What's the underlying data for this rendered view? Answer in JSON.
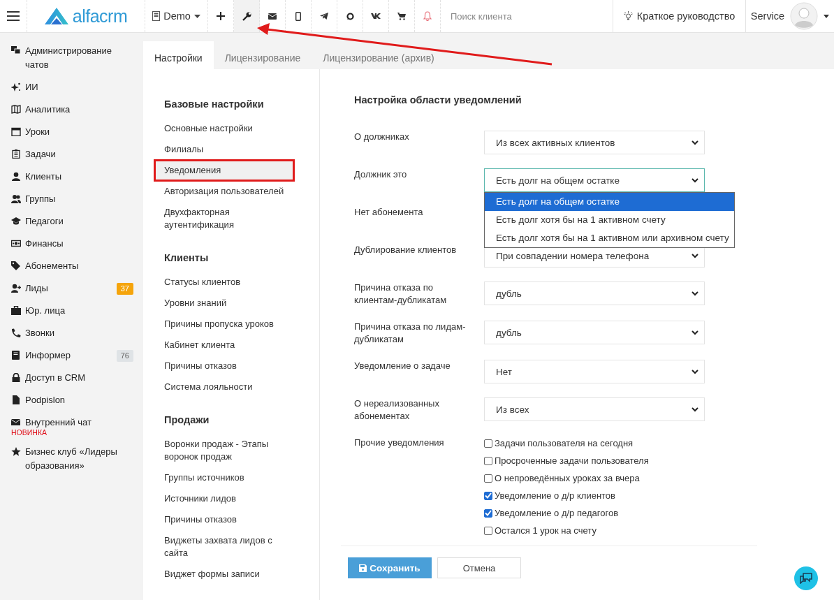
{
  "topbar": {
    "logo": "alfacrm",
    "branch": "Demo",
    "search": {
      "placeholder": "Поиск клиента"
    },
    "guide": "Краткое руководство",
    "user": "Service",
    "toolbar_buttons": [
      {
        "selected": false
      },
      {
        "selected": true
      },
      {
        "selected": false
      },
      {
        "selected": false
      },
      {
        "selected": false
      },
      {
        "selected": false
      },
      {
        "selected": false
      },
      {
        "selected": false
      },
      {
        "selected": false
      }
    ]
  },
  "sidebar": {
    "items": [
      {
        "label": "Администрирование чатов"
      },
      {
        "label": "ИИ"
      },
      {
        "label": "Аналитика"
      },
      {
        "label": "Уроки"
      },
      {
        "label": "Задачи"
      },
      {
        "label": "Клиенты"
      },
      {
        "label": "Группы"
      },
      {
        "label": "Педагоги"
      },
      {
        "label": "Финансы"
      },
      {
        "label": "Абонементы"
      },
      {
        "label": "Лиды",
        "badge": {
          "text": "37",
          "color": "#f5a40b"
        }
      },
      {
        "label": "Юр. лица"
      },
      {
        "label": "Звонки"
      },
      {
        "label": "Информер",
        "badge": {
          "text": "76",
          "color": "#dfe3e6"
        }
      },
      {
        "label": "Доступ в CRM"
      },
      {
        "label": "Podpislon"
      },
      {
        "label": "Внутренний чат",
        "note": "НОВИНКА"
      },
      {
        "label": "Бизнес клуб «Лидеры образования»"
      }
    ]
  },
  "tabs": [
    {
      "label": "Настройки",
      "selected": true
    },
    {
      "label": "Лицензирование",
      "selected": false
    },
    {
      "label": "Лицензирование (архив)",
      "selected": false
    }
  ],
  "settings_nav": [
    {
      "title": "Базовые настройки",
      "items": [
        {
          "label": "Основные настройки",
          "selected": false,
          "outlined": false
        },
        {
          "label": "Филиалы",
          "selected": false,
          "outlined": false
        },
        {
          "label": "Уведомления",
          "selected": true,
          "outlined": true
        },
        {
          "label": "Авторизация пользователей",
          "selected": false,
          "outlined": false
        },
        {
          "label": "Двухфакторная аутентификация",
          "selected": false,
          "outlined": false
        }
      ]
    },
    {
      "title": "Клиенты",
      "items": [
        {
          "label": "Статусы клиентов",
          "selected": false,
          "outlined": false
        },
        {
          "label": "Уровни знаний",
          "selected": false,
          "outlined": false
        },
        {
          "label": "Причины пропуска уроков",
          "selected": false,
          "outlined": false
        },
        {
          "label": "Кабинет клиента",
          "selected": false,
          "outlined": false
        },
        {
          "label": "Причины отказов",
          "selected": false,
          "outlined": false
        },
        {
          "label": "Система лояльности",
          "selected": false,
          "outlined": false
        }
      ]
    },
    {
      "title": "Продажи",
      "items": [
        {
          "label": "Воронки продаж - Этапы воронок продаж",
          "selected": false,
          "outlined": false
        },
        {
          "label": "Группы источников",
          "selected": false,
          "outlined": false
        },
        {
          "label": "Источники лидов",
          "selected": false,
          "outlined": false
        },
        {
          "label": "Причины отказов",
          "selected": false,
          "outlined": false
        },
        {
          "label": "Виджеты захвата лидов с сайта",
          "selected": false,
          "outlined": false
        },
        {
          "label": "Виджет формы записи",
          "selected": false,
          "outlined": false
        }
      ]
    }
  ],
  "form": {
    "title": "Настройка области уведомлений",
    "fields": [
      {
        "kind": "select",
        "label": "О должниках",
        "value": "Из всех активных клиентов",
        "focused": false
      },
      {
        "kind": "select",
        "label": "Должник это",
        "value": "Есть долг на общем остатке",
        "focused": true,
        "options": [
          {
            "label": "Есть долг на общем остатке",
            "selected": true
          },
          {
            "label": "Есть долг хотя бы на 1 активном счету",
            "selected": false
          },
          {
            "label": "Есть долг хотя бы на 1 активном или архивном счету",
            "selected": false
          }
        ]
      },
      {
        "kind": "hidden",
        "label": "Нет абонемента"
      },
      {
        "kind": "select",
        "label": "Дублирование клиентов",
        "value": "При совпадении номера телефона",
        "focused": false
      },
      {
        "kind": "select",
        "label": "Причина отказа по клиентам-дубликатам",
        "value": "дубль",
        "focused": false
      },
      {
        "kind": "select",
        "label": "Причина отказа по лидам-дубликатам",
        "value": "дубль",
        "focused": false
      },
      {
        "kind": "select",
        "label": "Уведомление о задаче",
        "value": "Нет",
        "focused": false
      },
      {
        "kind": "select",
        "label": "О нереализованных абонементах",
        "value": "Из всех",
        "focused": false
      },
      {
        "kind": "checks",
        "label": "Прочие уведомления",
        "checks": [
          {
            "label": "Задачи пользователя на сегодня",
            "checked": false
          },
          {
            "label": "Просроченные задачи пользователя",
            "checked": false
          },
          {
            "label": "О непроведённых уроках за вчера",
            "checked": false
          },
          {
            "label": "Уведомление о д/р клиентов",
            "checked": true
          },
          {
            "label": "Уведомление о д/р педагогов",
            "checked": true
          },
          {
            "label": "Остался 1 урок на счету",
            "checked": false
          }
        ]
      }
    ],
    "save": "Сохранить",
    "cancel": "Отмена"
  }
}
